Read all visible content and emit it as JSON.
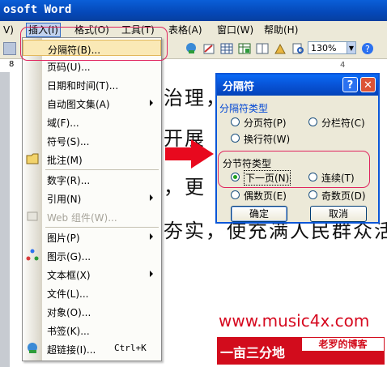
{
  "window": {
    "title": "osoft Word"
  },
  "menubar": {
    "items": [
      {
        "label": "V)",
        "active": false
      },
      {
        "label": "插入(I)",
        "active": true
      },
      {
        "label": "格式(O)",
        "active": false
      },
      {
        "label": "工具(T)",
        "active": false
      },
      {
        "label": "表格(A)",
        "active": false
      },
      {
        "label": "窗口(W)",
        "active": false
      },
      {
        "label": "帮助(H)",
        "active": false
      }
    ]
  },
  "toolbar": {
    "zoom": "130%"
  },
  "ruler": {
    "left_number": "8",
    "tick_label": "4"
  },
  "document": {
    "lines": [
      "治理，",
      "开展",
      "，更",
      "夯实，使充满人民群众活"
    ]
  },
  "insert_menu": {
    "items": [
      {
        "label": "分隔符(B)...",
        "highlighted": true
      },
      {
        "label": "页码(U)..."
      },
      {
        "label": "日期和时间(T)..."
      },
      {
        "label": "自动图文集(A)",
        "submenu": true
      },
      {
        "label": "域(F)..."
      },
      {
        "label": "符号(S)..."
      },
      {
        "label": "批注(M)",
        "icon": "comment-icon"
      },
      {
        "label": "数字(R)..."
      },
      {
        "label": "引用(N)",
        "submenu": true
      },
      {
        "label": "Web 组件(W)...",
        "disabled": true,
        "icon": "web-component-icon"
      },
      {
        "label": "图片(P)",
        "submenu": true
      },
      {
        "label": "图示(G)...",
        "icon": "diagram-icon"
      },
      {
        "label": "文本框(X)",
        "submenu": true
      },
      {
        "label": "文件(L)..."
      },
      {
        "label": "对象(O)..."
      },
      {
        "label": "书签(K)..."
      },
      {
        "label": "超链接(I)...",
        "shortcut": "Ctrl+K",
        "icon": "hyperlink-icon"
      }
    ]
  },
  "dialog": {
    "title": "分隔符",
    "break_types_label": "分隔符类型",
    "break_types": [
      {
        "label": "分页符(P)",
        "selected": false
      },
      {
        "label": "分栏符(C)",
        "selected": false
      },
      {
        "label": "换行符(W)",
        "selected": false
      }
    ],
    "section_types_label": "分节符类型",
    "section_types": [
      {
        "label": "下一页(N)",
        "selected": true
      },
      {
        "label": "连续(T)",
        "selected": false
      },
      {
        "label": "偶数页(E)",
        "selected": false
      },
      {
        "label": "奇数页(D)",
        "selected": false
      }
    ],
    "ok_label": "确定",
    "cancel_label": "取消"
  },
  "watermark": {
    "url": "www.music4x.com",
    "left_text": "一亩三分地",
    "right_text": "老罗的博客"
  },
  "colors": {
    "highlight": "#fae9b6",
    "annotation_ring": "#e0245e",
    "watermark_red": "#d20c1c",
    "title_blue": "#0a56d8"
  }
}
